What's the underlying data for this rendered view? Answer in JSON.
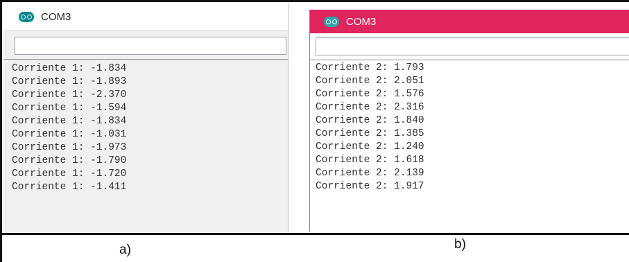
{
  "panel_a": {
    "title": "COM3",
    "input_value": "",
    "lines": [
      "Corriente 1: -1.834",
      "Corriente 1: -1.893",
      "Corriente 1: -2.370",
      "Corriente 1: -1.594",
      "Corriente 1: -1.834",
      "Corriente 1: -1.031",
      "Corriente 1: -1.973",
      "Corriente 1: -1.790",
      "Corriente 1: -1.720",
      "Corriente 1: -1.411"
    ],
    "caption": "a)",
    "titlebar_color": "#ffffff",
    "icon_color": "#00878f"
  },
  "panel_b": {
    "title": "COM3",
    "input_value": "",
    "lines": [
      "Corriente 2: 1.793",
      "Corriente 2: 2.051",
      "Corriente 2: 1.576",
      "Corriente 2: 2.316",
      "Corriente 2: 1.840",
      "Corriente 2: 1.385",
      "Corriente 2: 1.240",
      "Corriente 2: 1.618",
      "Corriente 2: 2.139",
      "Corriente 2: 1.917"
    ],
    "caption": "b)",
    "titlebar_color": "#e0245e",
    "icon_color": "#2aa6ad"
  }
}
